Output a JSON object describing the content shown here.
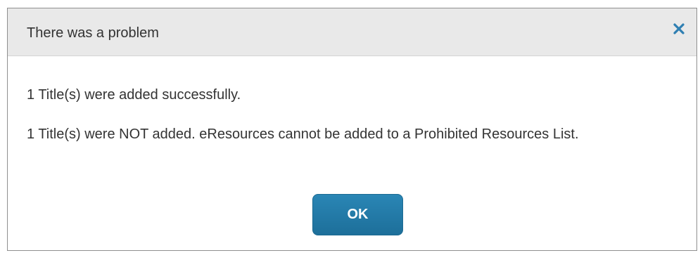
{
  "dialog": {
    "title": "There was a problem",
    "close_icon": "close-icon",
    "messages": [
      "1 Title(s) were added successfully.",
      "1 Title(s) were NOT added. eResources cannot be added to a Prohibited Resources List."
    ],
    "ok_label": "OK",
    "colors": {
      "header_bg": "#e9e9e9",
      "close_icon": "#2f7fb2",
      "ok_button": "#1f77a6",
      "text": "#333333"
    }
  }
}
